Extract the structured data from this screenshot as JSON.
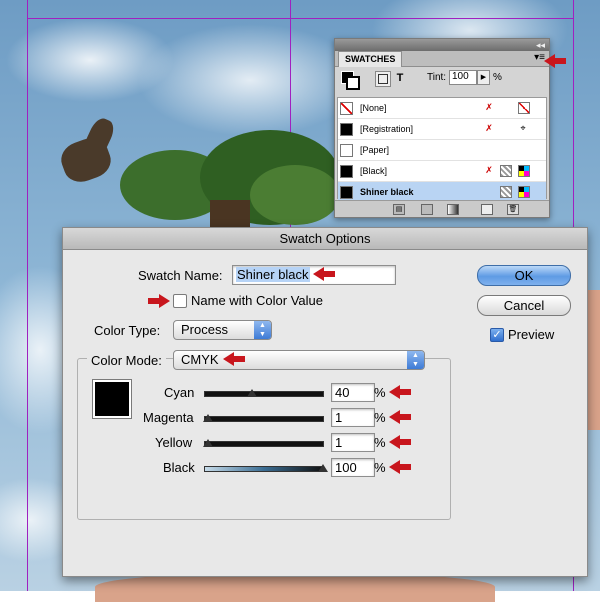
{
  "swatches_panel": {
    "tab_label": "SWATCHES",
    "close_glyph": "◂◂",
    "menu_glyph": "▾≡",
    "tint_label": "Tint:",
    "tint_value": "100",
    "tint_unit": "%",
    "text_tool": "T",
    "items": [
      {
        "name": "[None]",
        "color": "#ffffff"
      },
      {
        "name": "[Registration]",
        "color": "#000000"
      },
      {
        "name": "[Paper]",
        "color": "#ffffff"
      },
      {
        "name": "[Black]",
        "color": "#000000"
      },
      {
        "name": "Shiner black",
        "color": "#000000"
      }
    ]
  },
  "dialog": {
    "title": "Swatch Options",
    "swatch_name_label": "Swatch Name:",
    "swatch_name_value": "Shiner black",
    "name_with_color_value_label": "Name with Color Value",
    "name_with_color_value_checked": false,
    "color_type_label": "Color Type:",
    "color_type_value": "Process",
    "color_mode_label": "Color Mode:",
    "color_mode_value": "CMYK",
    "ok_label": "OK",
    "cancel_label": "Cancel",
    "preview_label": "Preview",
    "preview_checked": true,
    "check_glyph": "✓",
    "channels": [
      {
        "label": "Cyan",
        "value": "40",
        "unit": "%"
      },
      {
        "label": "Magenta",
        "value": "1",
        "unit": "%"
      },
      {
        "label": "Yellow",
        "value": "1",
        "unit": "%"
      },
      {
        "label": "Black",
        "value": "100",
        "unit": "%"
      }
    ]
  },
  "colors": {
    "annotation_arrow": "#c8161d",
    "ok_button": "#5f9be4",
    "selection_highlight": "#b6d3f6",
    "guide_line": "#a020c0"
  }
}
